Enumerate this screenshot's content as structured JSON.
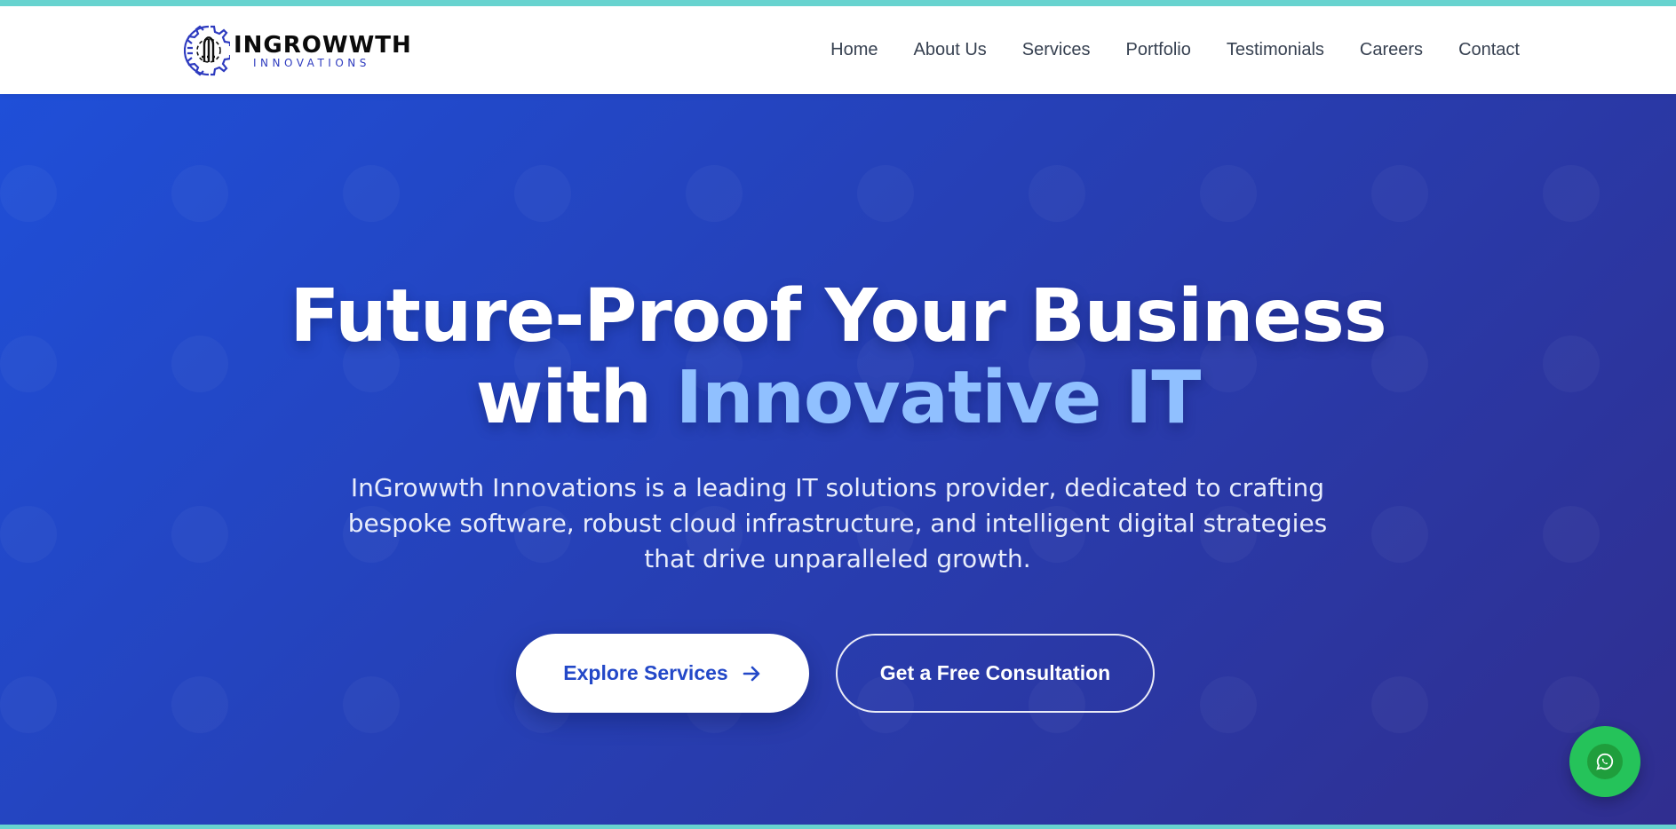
{
  "brand": {
    "name": "INGROWWTH",
    "tagline": "INNOVATIONS",
    "logo_icon": "gear-pen-icon"
  },
  "nav": {
    "items": [
      {
        "label": "Home"
      },
      {
        "label": "About Us"
      },
      {
        "label": "Services"
      },
      {
        "label": "Portfolio"
      },
      {
        "label": "Testimonials"
      },
      {
        "label": "Careers"
      },
      {
        "label": "Contact"
      }
    ]
  },
  "hero": {
    "title_line1": "Future-Proof Your Business",
    "title_line2_prefix": "with ",
    "title_line2_accent": "Innovative IT",
    "description": "InGrowwth Innovations is a leading IT solutions provider, dedicated to crafting bespoke software, robust cloud infrastructure, and intelligent digital strategies that drive unparalleled growth.",
    "primary_button": {
      "label": "Explore Services",
      "icon": "arrow-right-icon"
    },
    "secondary_button": {
      "label": "Get a Free Consultation"
    }
  },
  "floating": {
    "icon": "whatsapp-icon"
  },
  "colors": {
    "accent_border": "#67d3cf",
    "hero_start": "#1f4fd8",
    "hero_end": "#302e8f",
    "title_accent": "#90c0ff",
    "primary_text": "#2348c8",
    "whatsapp_green": "#25c35a"
  }
}
